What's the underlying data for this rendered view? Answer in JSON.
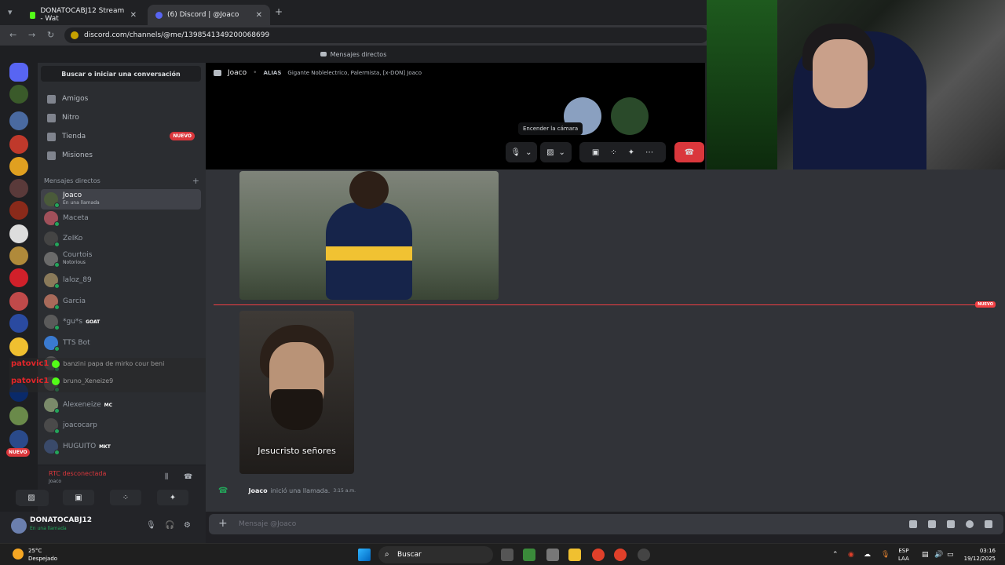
{
  "browser": {
    "tabs": [
      {
        "title": "DONATOCABJ12 Stream - Wat",
        "active": false
      },
      {
        "title": "(6) Discord | @Joaco",
        "active": true
      }
    ],
    "new_tab": "+",
    "url": "discord.com/channels/@me/1398541349200068699"
  },
  "discord": {
    "topstrip": "Mensajes directos",
    "search": "Buscar o iniciar una conversación",
    "nav": [
      {
        "label": "Amigos"
      },
      {
        "label": "Nitro"
      },
      {
        "label": "Tienda",
        "badge": "NUEVO"
      },
      {
        "label": "Misiones"
      }
    ],
    "server_badge": "NUEVO",
    "dm_header": "Mensajes directos",
    "dms": [
      {
        "name": "Joaco",
        "sub": "En una llamada",
        "selected": true,
        "color": "#4a5a3a"
      },
      {
        "name": "Maceta",
        "sub": "",
        "color": "#a0505a"
      },
      {
        "name": "ZeIKo",
        "sub": "",
        "color": "#444"
      },
      {
        "name": "Courtois",
        "sub": "Notorious",
        "color": "#6a6a6a"
      },
      {
        "name": "laloz_89",
        "sub": "",
        "color": "#8a7a5a"
      },
      {
        "name": "Garcia",
        "sub": "",
        "color": "#a86a5a"
      },
      {
        "name": "*gu*s",
        "sub": "",
        "tag": "GOAT",
        "color": "#5a5a5a"
      },
      {
        "name": "TTS Bot",
        "sub": "",
        "color": "#3a7ad0"
      },
      {
        "name": "",
        "sub": "",
        "color": "#555"
      },
      {
        "name": "",
        "sub": "",
        "color": "#555"
      },
      {
        "name": "Alexeneize",
        "sub": "",
        "tag": "MC",
        "color": "#7a8a6a"
      },
      {
        "name": "joacocarp",
        "sub": "",
        "color": "#4a4a4a"
      },
      {
        "name": "HUGUITO",
        "sub": "",
        "tag": "MKT",
        "color": "#3a4a6a"
      }
    ],
    "overlay_chat": [
      {
        "user": "patovic1",
        "msg": "banzini papa de mirko cour beni"
      },
      {
        "user": "patovic1",
        "msg": "bruno_Xeneize9"
      }
    ],
    "rtc": {
      "status": "RTC desconectada",
      "channel": "Joaco"
    },
    "user": {
      "name": "DONATOCABJ12",
      "status": "En una llamada"
    },
    "call": {
      "name": "Joaco",
      "alias_label": "ALIAS",
      "alias": "Gigante Noblelectrico, Palermista, [x-DON] Joaco",
      "tooltip": "Encender la cámara"
    },
    "chat": {
      "new_divider": "NUEVO",
      "image_caption": "Jesucristo señores",
      "call_msg_user": "Joaco",
      "call_msg_text": "inició una llamada.",
      "call_msg_time": "3:15 a.m."
    },
    "composer_placeholder": "Mensaje @Joaco"
  },
  "taskbar": {
    "temp": "25°C",
    "weather": "Despejado",
    "search": "Buscar",
    "lang1": "ESP",
    "lang2": "LAA",
    "time": "03:16",
    "date": "19/12/2025"
  },
  "colors": {
    "accent": "#5865f2",
    "danger": "#da373c",
    "online": "#23a55a"
  }
}
